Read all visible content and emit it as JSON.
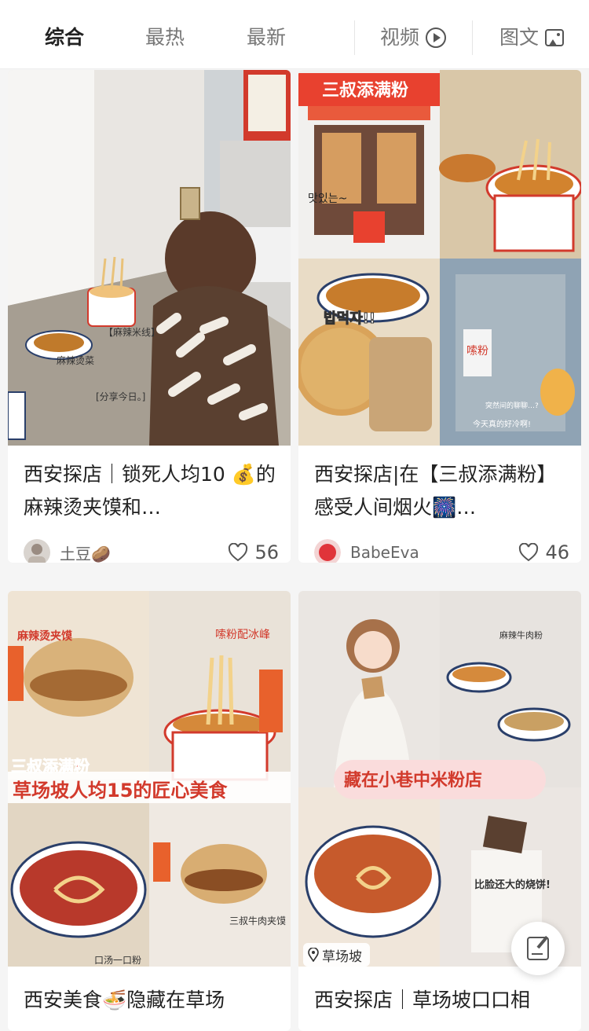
{
  "tabs": {
    "zonghe": "综合",
    "zuire": "最热",
    "zuixin": "最新",
    "video": "视频",
    "image": "图文",
    "video_icon": "play-circle-icon",
    "image_icon": "image-icon"
  },
  "colors": {
    "active_tab": "#222222",
    "inactive_tab": "#777777",
    "background": "#f5f5f5",
    "card": "#ffffff",
    "poster_red": "#e8412f"
  },
  "cards": [
    {
      "title": "西安探店｜锁死人均10 💰的麻辣烫夹馍和…",
      "author": "土豆🥔",
      "likes": "56",
      "cover_texts": [
        "【麻辣米线】",
        "麻辣烫菜",
        "[分享今日。]"
      ]
    },
    {
      "title": "西安探店|在【三叔添满粉】感受人间烟火🎆…",
      "author": "BabeEva",
      "likes": "46",
      "cover_texts": [
        "三叔添满粉",
        "맛있는~",
        "밥먹자!!",
        "嗦粉",
        "今天真的好冷啊!",
        "突然间的聊聊…?"
      ]
    },
    {
      "title": "西安美食🍜隐藏在草场",
      "cover_texts": [
        "麻辣烫夹馍",
        "嗦粉配冰峰",
        "三叔添满粉",
        "草场坡人均15的匠心美食",
        "三叔牛肉夹馍",
        "口汤一口粉"
      ]
    },
    {
      "title": "西安探店｜草场坡口口相",
      "location": "草场坡",
      "cover_texts": [
        "麻辣牛肉粉",
        "藏在小巷中米粉店",
        "比脸还大的烧饼!"
      ]
    }
  ],
  "fab_icon": "edit-note-icon"
}
